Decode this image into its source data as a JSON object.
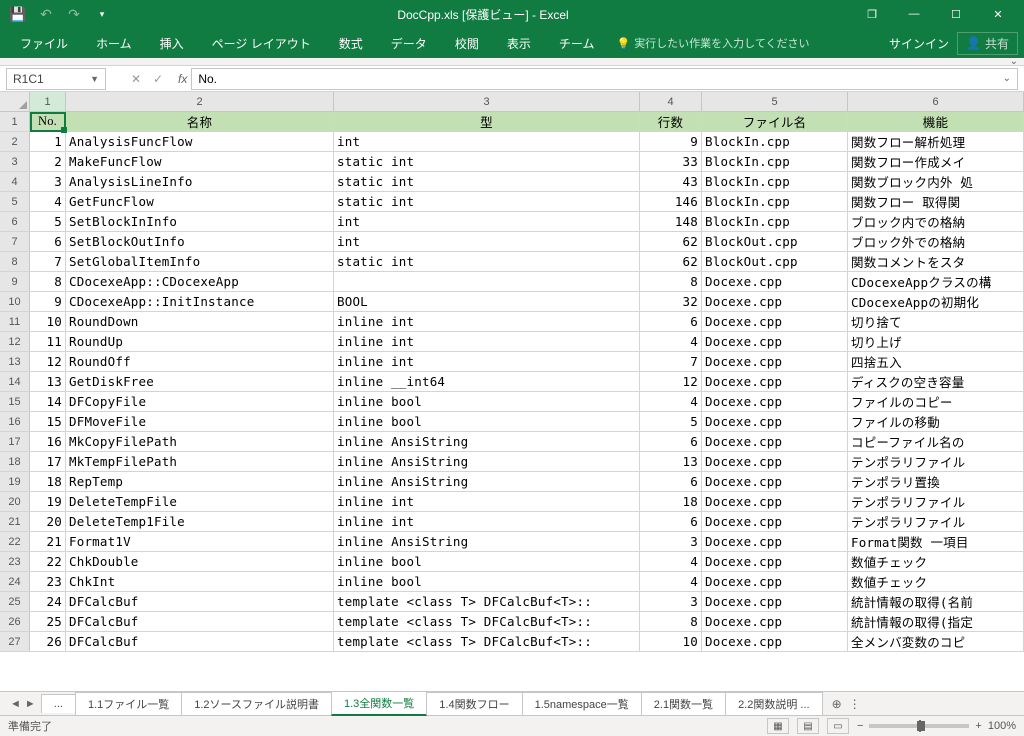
{
  "title": "DocCpp.xls [保護ビュー] - Excel",
  "qat": {
    "save": "💾",
    "undo": "↶",
    "redo": "↷",
    "customize": "▾"
  },
  "win": {
    "opts": "❐",
    "min": "—",
    "max": "☐",
    "close": "✕"
  },
  "ribbon": {
    "file": "ファイル",
    "home": "ホーム",
    "insert": "挿入",
    "layout": "ページ レイアウト",
    "formulas": "数式",
    "data": "データ",
    "review": "校閲",
    "view": "表示",
    "team": "チーム",
    "tellme": "実行したい作業を入力してください",
    "signin": "サインイン",
    "share": "共有"
  },
  "namebox": "R1C1",
  "formula": "No.",
  "cols": [
    "1",
    "2",
    "3",
    "4",
    "5",
    "6"
  ],
  "headers": {
    "no": "No.",
    "name": "名称",
    "type": "型",
    "lines": "行数",
    "file": "ファイル名",
    "func": "機能"
  },
  "rows": [
    {
      "n": 1,
      "name": "AnalysisFuncFlow",
      "type": "int",
      "ln": 9,
      "file": "BlockIn.cpp",
      "f": "関数フロー解析処理"
    },
    {
      "n": 2,
      "name": "MakeFuncFlow",
      "type": "static int",
      "ln": 33,
      "file": "BlockIn.cpp",
      "f": "関数フロー作成メイ"
    },
    {
      "n": 3,
      "name": "AnalysisLineInfo",
      "type": "static int",
      "ln": 43,
      "file": "BlockIn.cpp",
      "f": "関数ブロック内外 処"
    },
    {
      "n": 4,
      "name": "GetFuncFlow",
      "type": "static int",
      "ln": 146,
      "file": "BlockIn.cpp",
      "f": "関数フロー  取得関"
    },
    {
      "n": 5,
      "name": "SetBlockInInfo",
      "type": "int",
      "ln": 148,
      "file": "BlockIn.cpp",
      "f": "ブロック内での格納"
    },
    {
      "n": 6,
      "name": "SetBlockOutInfo",
      "type": "int",
      "ln": 62,
      "file": "BlockOut.cpp",
      "f": "ブロック外での格納"
    },
    {
      "n": 7,
      "name": "SetGlobalItemInfo",
      "type": "static int",
      "ln": 62,
      "file": "BlockOut.cpp",
      "f": "関数コメントをスタ"
    },
    {
      "n": 8,
      "name": "CDocexeApp::CDocexeApp",
      "type": "",
      "ln": 8,
      "file": "Docexe.cpp",
      "f": "CDocexeAppクラスの構"
    },
    {
      "n": 9,
      "name": "CDocexeApp::InitInstance",
      "type": "BOOL",
      "ln": 32,
      "file": "Docexe.cpp",
      "f": "CDocexeAppの初期化"
    },
    {
      "n": 10,
      "name": "RoundDown",
      "type": "inline int",
      "ln": 6,
      "file": "Docexe.cpp",
      "f": "切り捨て"
    },
    {
      "n": 11,
      "name": "RoundUp",
      "type": "inline int",
      "ln": 4,
      "file": "Docexe.cpp",
      "f": "切り上げ"
    },
    {
      "n": 12,
      "name": "RoundOff",
      "type": "inline int",
      "ln": 7,
      "file": "Docexe.cpp",
      "f": "四捨五入"
    },
    {
      "n": 13,
      "name": "GetDiskFree",
      "type": "inline __int64",
      "ln": 12,
      "file": "Docexe.cpp",
      "f": "ディスクの空き容量"
    },
    {
      "n": 14,
      "name": "DFCopyFile",
      "type": "inline bool",
      "ln": 4,
      "file": "Docexe.cpp",
      "f": "ファイルのコピー"
    },
    {
      "n": 15,
      "name": "DFMoveFile",
      "type": "inline bool",
      "ln": 5,
      "file": "Docexe.cpp",
      "f": "ファイルの移動"
    },
    {
      "n": 16,
      "name": "MkCopyFilePath",
      "type": "inline AnsiString",
      "ln": 6,
      "file": "Docexe.cpp",
      "f": "コピーファイル名の"
    },
    {
      "n": 17,
      "name": "MkTempFilePath",
      "type": "inline AnsiString",
      "ln": 13,
      "file": "Docexe.cpp",
      "f": "テンポラリファイル"
    },
    {
      "n": 18,
      "name": "RepTemp",
      "type": "inline AnsiString",
      "ln": 6,
      "file": "Docexe.cpp",
      "f": "テンポラリ置換"
    },
    {
      "n": 19,
      "name": "DeleteTempFile",
      "type": "inline int",
      "ln": 18,
      "file": "Docexe.cpp",
      "f": "テンポラリファイル"
    },
    {
      "n": 20,
      "name": "DeleteTemp1File",
      "type": "inline int",
      "ln": 6,
      "file": "Docexe.cpp",
      "f": "テンポラリファイル"
    },
    {
      "n": 21,
      "name": "Format1V",
      "type": "inline AnsiString",
      "ln": 3,
      "file": "Docexe.cpp",
      "f": "Format関数  一項目"
    },
    {
      "n": 22,
      "name": "ChkDouble",
      "type": "inline bool",
      "ln": 4,
      "file": "Docexe.cpp",
      "f": "数値チェック"
    },
    {
      "n": 23,
      "name": "ChkInt",
      "type": "inline bool",
      "ln": 4,
      "file": "Docexe.cpp",
      "f": "数値チェック"
    },
    {
      "n": 24,
      "name": "DFCalcBuf",
      "type": "template <class T> DFCalcBuf<T>::",
      "ln": 3,
      "file": "Docexe.cpp",
      "f": "統計情報の取得(名前"
    },
    {
      "n": 25,
      "name": "DFCalcBuf",
      "type": "template <class T> DFCalcBuf<T>::",
      "ln": 8,
      "file": "Docexe.cpp",
      "f": "統計情報の取得(指定"
    },
    {
      "n": 26,
      "name": "DFCalcBuf",
      "type": "template <class T> DFCalcBuf<T>::",
      "ln": 10,
      "file": "Docexe.cpp",
      "f": "全メンバ変数のコピ"
    }
  ],
  "sheets": {
    "more": "...",
    "s1": "1.1ファイル一覧",
    "s2": "1.2ソースファイル説明書",
    "s3": "1.3全関数一覧",
    "s4": "1.4関数フロー",
    "s5": "1.5namespace一覧",
    "s6": "2.1関数一覧",
    "s7": "2.2関数説明"
  },
  "status": {
    "ready": "準備完了",
    "zoom": "100%"
  }
}
